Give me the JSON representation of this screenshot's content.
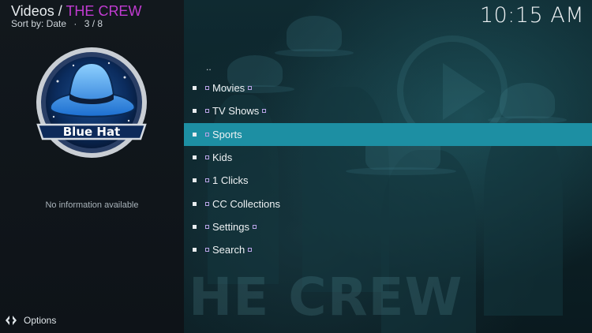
{
  "header": {
    "section": "Videos",
    "separator": "/",
    "breadcrumb": "THE CREW",
    "sort_label": "Sort by: Date",
    "dot": "·",
    "position": "3 / 8"
  },
  "clock": "10:15 AM",
  "logo": {
    "text": "Blue Hat"
  },
  "info": {
    "no_info": "No information available"
  },
  "footer": {
    "options_label": "Options"
  },
  "fanart": {
    "title_text": "HE CREW"
  },
  "menu": {
    "parent_label": "..",
    "items": [
      {
        "label": "Movies",
        "selected": false,
        "has_post_mark": true
      },
      {
        "label": "TV Shows",
        "selected": false,
        "has_post_mark": true
      },
      {
        "label": "Sports",
        "selected": true,
        "has_post_mark": false
      },
      {
        "label": "Kids",
        "selected": false,
        "has_post_mark": false
      },
      {
        "label": "1 Clicks",
        "selected": false,
        "has_post_mark": false
      },
      {
        "label": "CC Collections",
        "selected": false,
        "has_post_mark": false
      },
      {
        "label": "Settings",
        "selected": false,
        "has_post_mark": true
      },
      {
        "label": "Search",
        "selected": false,
        "has_post_mark": true
      }
    ]
  },
  "colors": {
    "accent": "#1d8fa3",
    "breadcrumb": "#c13bd1",
    "background": "#0b1014"
  }
}
